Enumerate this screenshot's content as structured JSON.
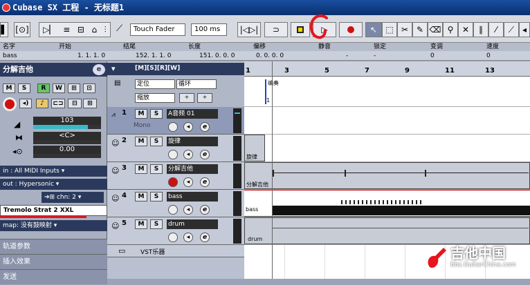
{
  "window": {
    "title": "Cubase SX 工程 - 无标题1"
  },
  "toolbar": {
    "touch_fader": "Touch Fader",
    "fade_time": "100 ms"
  },
  "info_line": {
    "headers": [
      "名字",
      "开始",
      "结尾",
      "长度",
      "偏移",
      "静音",
      "锁定",
      "变调",
      "速度"
    ],
    "values": [
      "bass",
      "1. 1. 1.   0",
      "152. 1. 1.   0",
      "151. 0. 0.   0",
      "0. 0. 0.   0",
      "-",
      "-",
      "0",
      "0"
    ]
  },
  "inspector": {
    "track_name": "分解吉他",
    "volume": "103",
    "pan": "<C>",
    "delay": "0.00",
    "input": "All MIDI Inputs",
    "output": "Hypersonic",
    "channel_label": "chn:",
    "channel": "2",
    "program": "Tremolo Strat 2 XXL",
    "map_label": "map:",
    "map": "没有鼓映射",
    "sections": [
      "轨道参数",
      "插入效果",
      "发送"
    ]
  },
  "track_header": {
    "locate": "定位",
    "cycle": "循环",
    "zoom": "缩放"
  },
  "tracks": [
    {
      "num": "1",
      "name": "A音频 01",
      "mode": "Mono"
    },
    {
      "num": "2",
      "name": "旋律"
    },
    {
      "num": "3",
      "name": "分解吉他"
    },
    {
      "num": "4",
      "name": "bass"
    },
    {
      "num": "5",
      "name": "drum"
    }
  ],
  "folder": {
    "name": "VST乐器"
  },
  "ruler": {
    "marks": [
      "1",
      "3",
      "5",
      "7",
      "9",
      "11",
      "13"
    ]
  },
  "parts": {
    "marker": "编奏",
    "marker_num": "1",
    "melody": "旋律",
    "guitar": "分解吉他",
    "bass": "bass",
    "drum": "drum"
  },
  "watermark": {
    "title": "吉他中国",
    "url": "bbs.GuitarChina.com"
  },
  "colors": {
    "accent": "#1a4fa0",
    "annotation": "#e8141e",
    "meter": "#3bb8c8"
  }
}
